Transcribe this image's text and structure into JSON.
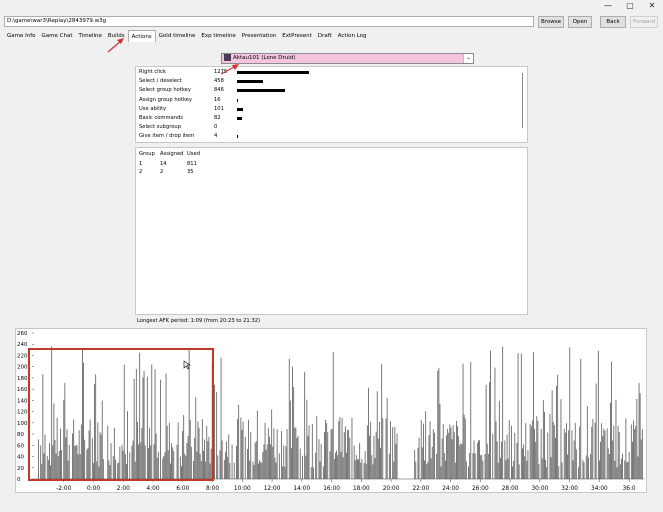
{
  "window": {
    "minimize": "—",
    "maximize": "▢",
    "close": "✕"
  },
  "toolbar": {
    "path": "D:\\game\\war3\\Replay\\2843979.w3g",
    "browse": "Browse",
    "open": "Open",
    "back": "Back",
    "forward": "Forward"
  },
  "tabs": [
    "Game Info",
    "Game Chat",
    "Timeline",
    "Builds",
    "Actions",
    "Gold timeline",
    "Exp timeline",
    "Presentation",
    "ExtPresent",
    "Draft",
    "Action Log"
  ],
  "active_tab": "Actions",
  "player_select": {
    "value": "Aktau101 (Lone Druid)"
  },
  "actions": [
    {
      "label": "Right click",
      "count": "1275",
      "value": 1275
    },
    {
      "label": "Select / deselect",
      "count": "458",
      "value": 458
    },
    {
      "label": "Select group hotkey",
      "count": "846",
      "value": 846
    },
    {
      "label": "Assign group hotkey",
      "count": "16",
      "value": 16
    },
    {
      "label": "Use ability",
      "count": "101",
      "value": 101
    },
    {
      "label": "Basic commands",
      "count": "82",
      "value": 82
    },
    {
      "label": "Select subgroup",
      "count": "0",
      "value": 0
    },
    {
      "label": "Give item / drop item",
      "count": "4",
      "value": 4
    }
  ],
  "groups": {
    "headers": [
      "Group",
      "Assigned",
      "Used"
    ],
    "rows": [
      [
        "1",
        "14",
        "811"
      ],
      [
        "2",
        "2",
        "35"
      ]
    ]
  },
  "afk_text": "Longest AFK period: 1:09 (from 20:23 to 21:32)",
  "chart_data": {
    "type": "bar",
    "ylim": [
      0,
      260
    ],
    "y_ticks": [
      "260",
      "240",
      "220",
      "200",
      "180",
      "160",
      "140",
      "120",
      "100",
      "80",
      "60",
      "40",
      "20",
      "0"
    ],
    "x_ticks": [
      "-2:00",
      "0:00",
      "2:00",
      "4:00",
      "6:00",
      "8:00",
      "10:00",
      "12:00",
      "14:00",
      "16:00",
      "18:00",
      "20:00",
      "22:00",
      "24:00",
      "26:00",
      "28:00",
      "30:00",
      "32:00",
      "34:00",
      "36:0"
    ],
    "xlim_minutes": [
      -4,
      37
    ],
    "description_series": {
      "name": ""
    },
    "bins_note": ""
  }
}
